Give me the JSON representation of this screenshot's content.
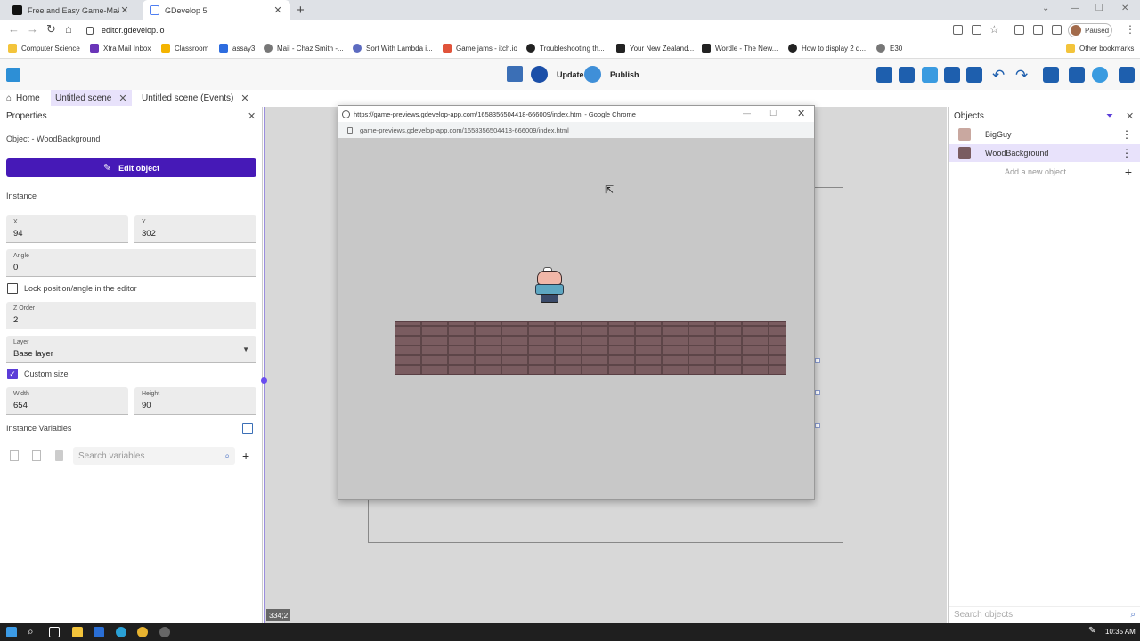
{
  "browser": {
    "tabs": [
      {
        "title": "Free and Easy Game-Making App"
      },
      {
        "title": "GDevelop 5"
      }
    ],
    "new_tab": "+",
    "url": "editor.gdevelop.io",
    "profile_status": "Paused",
    "bookmarks": [
      "Computer Science",
      "Xtra Mail Inbox",
      "Classroom",
      "assay3",
      "Mail - Chaz Smith -...",
      "Sort With Lambda i...",
      "Game jams - itch.io",
      "Troubleshooting th...",
      "Your New Zealand...",
      "Wordle - The New...",
      "How to display 2 d...",
      "E30"
    ],
    "other_bookmarks": "Other bookmarks"
  },
  "toolbar": {
    "update_label": "Update",
    "publish_label": "Publish"
  },
  "scene_tabs": [
    {
      "label": "Home"
    },
    {
      "label": "Untitled scene"
    },
    {
      "label": "Untitled scene (Events)"
    }
  ],
  "properties": {
    "title": "Properties",
    "object_line": "Object  - WoodBackground",
    "edit_object_label": "Edit object",
    "instance_heading": "Instance",
    "x_label": "X",
    "x_value": "94",
    "y_label": "Y",
    "y_value": "302",
    "angle_label": "Angle",
    "angle_value": "0",
    "lock_label": "Lock position/angle in the editor",
    "lock_checked": false,
    "z_label": "Z Order",
    "z_value": "2",
    "layer_label": "Layer",
    "layer_value": "Base layer",
    "custom_size_label": "Custom size",
    "custom_size_checked": true,
    "width_label": "Width",
    "width_value": "654",
    "height_label": "Height",
    "height_value": "90",
    "instance_vars_label": "Instance Variables",
    "search_vars_placeholder": "Search variables"
  },
  "scene": {
    "coord_readout": "334;2"
  },
  "preview_window": {
    "title": "https://game-previews.gdevelop-app.com/1658356504418-666009/index.html - Google Chrome",
    "url": "game-previews.gdevelop-app.com/1658356504418-666009/index.html"
  },
  "objects_panel": {
    "title": "Objects",
    "items": [
      {
        "name": "BigGuy"
      },
      {
        "name": "WoodBackground"
      }
    ],
    "add_label": "Add a new object",
    "search_placeholder": "Search objects"
  },
  "taskbar": {
    "time": "10:35 AM"
  },
  "colors": {
    "accent": "#4619b7",
    "selection": "#e8e2fb"
  }
}
